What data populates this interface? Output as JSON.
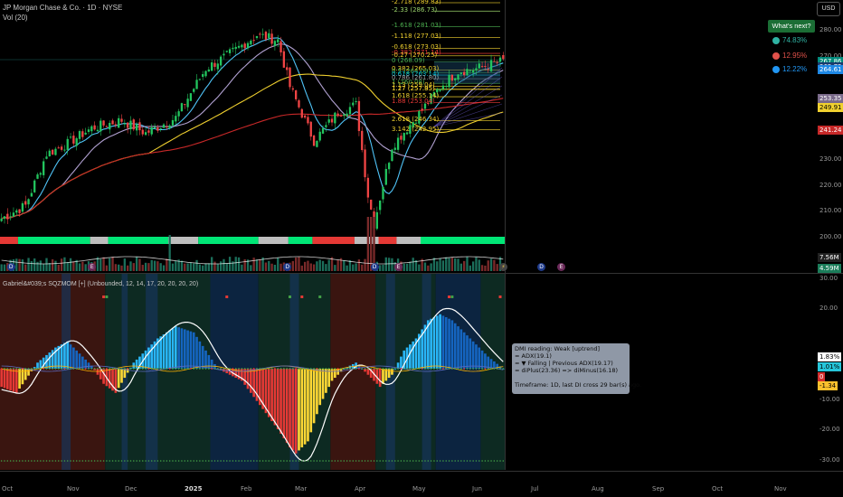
{
  "header": {
    "symbol_title": "JP Morgan Chase & Co. · 1D · NYSE",
    "volume_label": "Vol (20)",
    "oscillator_label": "Gabriel&#039;s SQZMOM [+] (Unbounded, 12, 14, 17, 20, 20, 20, 20)"
  },
  "currency_button": "USD",
  "whats_next": {
    "button": "What's next?",
    "items": [
      {
        "pct": "74.83%",
        "color": "#2fb3a3"
      },
      {
        "pct": "12.95%",
        "color": "#e0514a"
      },
      {
        "pct": "12.22%",
        "color": "#2196f3"
      }
    ]
  },
  "fib_levels": [
    {
      "label": "-2.718 (289.83)",
      "color": "#f0d02f"
    },
    {
      "label": "-2.33 (286.73)",
      "color": "#9bd36b"
    },
    {
      "label": "-1.618 (281.03)",
      "color": "#4caf50"
    },
    {
      "label": "-1.118 (277.03)",
      "color": "#f0d02f"
    },
    {
      "label": "-0.618 (273.03)",
      "color": "#f0d02f"
    },
    {
      "label": "-0.382 (271.14)",
      "color": "#e53935"
    },
    {
      "label": "-0.27 (270.25)",
      "color": "#f0d02f"
    },
    {
      "label": "0 (268.09)",
      "color": "#4caf50"
    },
    {
      "label": "0.382 (265.03)",
      "color": "#f0d02f"
    },
    {
      "label": "0.5 (264.09)",
      "color": "#4caf50"
    },
    {
      "label": "0.618 (263.14)",
      "color": "#00bcd4"
    },
    {
      "label": "0.786 (261.80)",
      "color": "#9e9e9e"
    },
    {
      "label": "1 (260.08)",
      "color": "#4caf50"
    },
    {
      "label": "1.13 (259.04)",
      "color": "#f0d02f"
    },
    {
      "label": "1.17 (257.85)",
      "color": "#f0d02f"
    },
    {
      "label": "1.27 (257.95)",
      "color": "#f0d02f"
    },
    {
      "label": "1.618 (255.14)",
      "color": "#f0d02f"
    },
    {
      "label": "1.88 (253.04)",
      "color": "#e53935"
    },
    {
      "label": "2.618 (246.34)",
      "color": "#f0d02f"
    },
    {
      "label": "3.142 (242.95)",
      "color": "#f0d02f"
    }
  ],
  "price_axis": {
    "ticks": [
      "280.00",
      "270.00",
      "230.00",
      "220.00",
      "210.00",
      "200.00"
    ],
    "badges": [
      {
        "text": "267.86",
        "bg": "#00897b",
        "fg": "#ffffff",
        "price": 267.86
      },
      {
        "text": "265.72",
        "bg": "#1a3b6e",
        "fg": "#ffffff",
        "price": 265.72
      },
      {
        "text": "264.61",
        "bg": "#1e88e5",
        "fg": "#ffffff",
        "price": 264.61
      },
      {
        "text": "253.35",
        "bg": "#7a6a8a",
        "fg": "#ffffff",
        "price": 253.35
      },
      {
        "text": "249.91",
        "bg": "#f0d02f",
        "fg": "#000000",
        "price": 249.91
      },
      {
        "text": "241.24",
        "bg": "#c62828",
        "fg": "#ffffff",
        "price": 241.24
      }
    ],
    "vol_badges": [
      {
        "text": "7.56M",
        "bg": "#222222",
        "fg": "#ffffff"
      },
      {
        "text": "4.59M",
        "bg": "#1b7d5a",
        "fg": "#ffffff"
      }
    ]
  },
  "osc_axis": {
    "ticks": [
      "30.00",
      "20.00",
      "-10.00",
      "-20.00",
      "-30.00"
    ],
    "badges": [
      {
        "text": "1.83%",
        "bg": "#ffffff",
        "fg": "#000000"
      },
      {
        "text": "1.01%",
        "bg": "#26c6da",
        "fg": "#000000"
      },
      {
        "text": "0",
        "bg": "#d32f2f",
        "fg": "#ffffff"
      },
      {
        "text": "-1.34",
        "bg": "#fbc02d",
        "fg": "#000000"
      }
    ]
  },
  "time_axis": [
    "Oct",
    "Nov",
    "Dec",
    "2025",
    "Feb",
    "Mar",
    "Apr",
    "May",
    "Jun",
    "Jul",
    "Aug",
    "Sep",
    "Oct",
    "Nov"
  ],
  "event_markers": {
    "dividend": "D",
    "earnings": "E"
  },
  "dmi_tooltip": {
    "lines": [
      "DMI reading: Weak [uptrend]",
      "= ADX(19.1)",
      "= ▼ Falling | Previous ADX(19.17)",
      "= diPlus(23.36) => diMinus(16.18)",
      "",
      "Timeframe: 1D, last DI cross 29 bar(s) ago."
    ]
  },
  "colors": {
    "up": "#26a69a",
    "down": "#ef5350",
    "candle_up": "#22c55e",
    "candle_down": "#ef4444",
    "hist_up_strong": "#29b6f6",
    "hist_up_weak": "#1565c0",
    "hist_down_strong": "#e53935",
    "hist_down_weak": "#fdd835"
  }
}
